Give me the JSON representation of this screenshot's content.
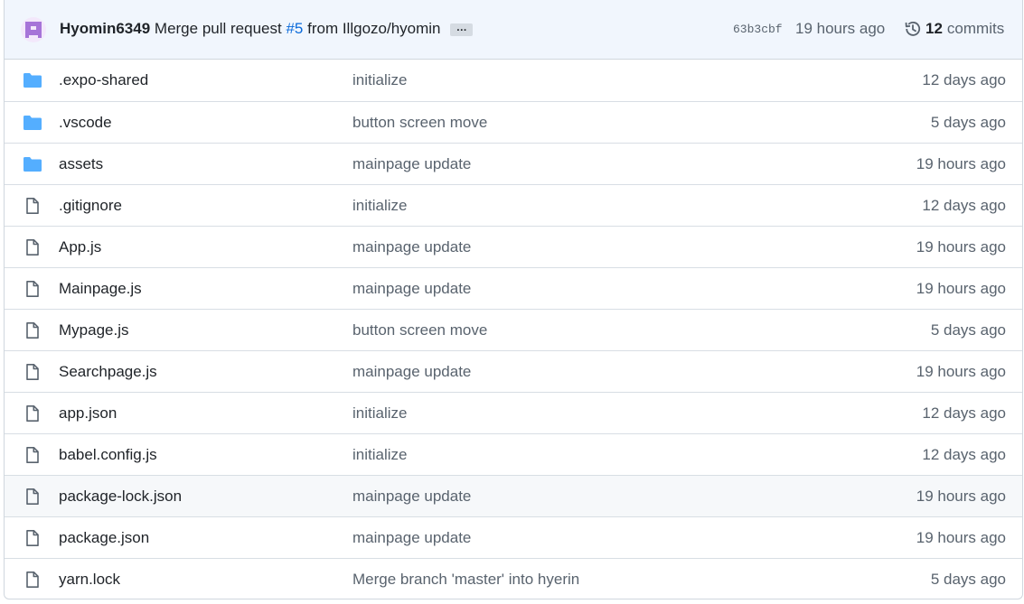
{
  "commit": {
    "author": "Hyomin6349",
    "message": "Merge pull request",
    "pr_link": "#5",
    "from_text": "from Illgozo/hyomin",
    "ellipsis": "…",
    "sha": "63b3cbf",
    "time": "19 hours ago",
    "commit_count": "12",
    "commit_label": "commits"
  },
  "files": [
    {
      "type": "folder",
      "name": ".expo-shared",
      "message": "initialize",
      "age": "12 days ago"
    },
    {
      "type": "folder",
      "name": ".vscode",
      "message": "button screen move",
      "age": "5 days ago"
    },
    {
      "type": "folder",
      "name": "assets",
      "message": "mainpage update",
      "age": "19 hours ago"
    },
    {
      "type": "file",
      "name": ".gitignore",
      "message": "initialize",
      "age": "12 days ago"
    },
    {
      "type": "file",
      "name": "App.js",
      "message": "mainpage update",
      "age": "19 hours ago"
    },
    {
      "type": "file",
      "name": "Mainpage.js",
      "message": "mainpage update",
      "age": "19 hours ago"
    },
    {
      "type": "file",
      "name": "Mypage.js",
      "message": "button screen move",
      "age": "5 days ago"
    },
    {
      "type": "file",
      "name": "Searchpage.js",
      "message": "mainpage update",
      "age": "19 hours ago"
    },
    {
      "type": "file",
      "name": "app.json",
      "message": "initialize",
      "age": "12 days ago"
    },
    {
      "type": "file",
      "name": "babel.config.js",
      "message": "initialize",
      "age": "12 days ago"
    },
    {
      "type": "file",
      "name": "package-lock.json",
      "message": "mainpage update",
      "age": "19 hours ago",
      "highlighted": true
    },
    {
      "type": "file",
      "name": "package.json",
      "message": "mainpage update",
      "age": "19 hours ago"
    },
    {
      "type": "file",
      "name": "yarn.lock",
      "message": "Merge branch 'master' into hyerin",
      "age": "5 days ago"
    }
  ],
  "colors": {
    "folder": "#54aeff",
    "file_icon": "#59636e",
    "link": "#0969da",
    "header_bg": "#f1f6fd",
    "avatar": "#a674d8"
  }
}
